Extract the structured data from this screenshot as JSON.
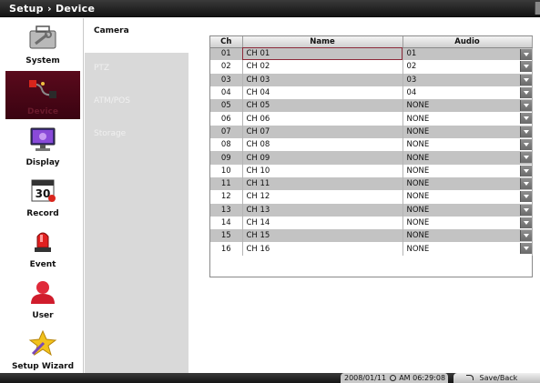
{
  "window": {
    "title": "Setup › Device"
  },
  "sidebar": {
    "items": [
      {
        "label": "System",
        "icon": "wrench-panel-icon"
      },
      {
        "label": "Device",
        "icon": "cable-connector-icon"
      },
      {
        "label": "Display",
        "icon": "monitor-icon"
      },
      {
        "label": "Record",
        "icon": "calendar-record-icon"
      },
      {
        "label": "Event",
        "icon": "siren-icon"
      },
      {
        "label": "User",
        "icon": "user-icon"
      },
      {
        "label": "Setup Wizard",
        "icon": "star-wand-icon"
      }
    ],
    "active": "Device"
  },
  "submenu": {
    "items": [
      {
        "label": "Camera"
      },
      {
        "label": "PTZ"
      },
      {
        "label": "ATM/POS"
      },
      {
        "label": "Storage"
      }
    ],
    "active": "Camera"
  },
  "table": {
    "headers": {
      "ch": "Ch",
      "name": "Name",
      "audio": "Audio"
    },
    "rows": [
      {
        "ch": "01",
        "name": "CH 01",
        "audio": "01"
      },
      {
        "ch": "02",
        "name": "CH 02",
        "audio": "02"
      },
      {
        "ch": "03",
        "name": "CH 03",
        "audio": "03"
      },
      {
        "ch": "04",
        "name": "CH 04",
        "audio": "04"
      },
      {
        "ch": "05",
        "name": "CH 05",
        "audio": "NONE"
      },
      {
        "ch": "06",
        "name": "CH 06",
        "audio": "NONE"
      },
      {
        "ch": "07",
        "name": "CH 07",
        "audio": "NONE"
      },
      {
        "ch": "08",
        "name": "CH 08",
        "audio": "NONE"
      },
      {
        "ch": "09",
        "name": "CH 09",
        "audio": "NONE"
      },
      {
        "ch": "10",
        "name": "CH 10",
        "audio": "NONE"
      },
      {
        "ch": "11",
        "name": "CH 11",
        "audio": "NONE"
      },
      {
        "ch": "12",
        "name": "CH 12",
        "audio": "NONE"
      },
      {
        "ch": "13",
        "name": "CH 13",
        "audio": "NONE"
      },
      {
        "ch": "14",
        "name": "CH 14",
        "audio": "NONE"
      },
      {
        "ch": "15",
        "name": "CH 15",
        "audio": "NONE"
      },
      {
        "ch": "16",
        "name": "CH 16",
        "audio": "NONE"
      }
    ]
  },
  "status": {
    "datetime_date": "2008/01/11",
    "datetime_time": "AM 06:29:08",
    "save_label": "Save/Back"
  },
  "colors": {
    "active_accent": "#5a0a1c",
    "selected_outline": "#8c2a3a"
  }
}
